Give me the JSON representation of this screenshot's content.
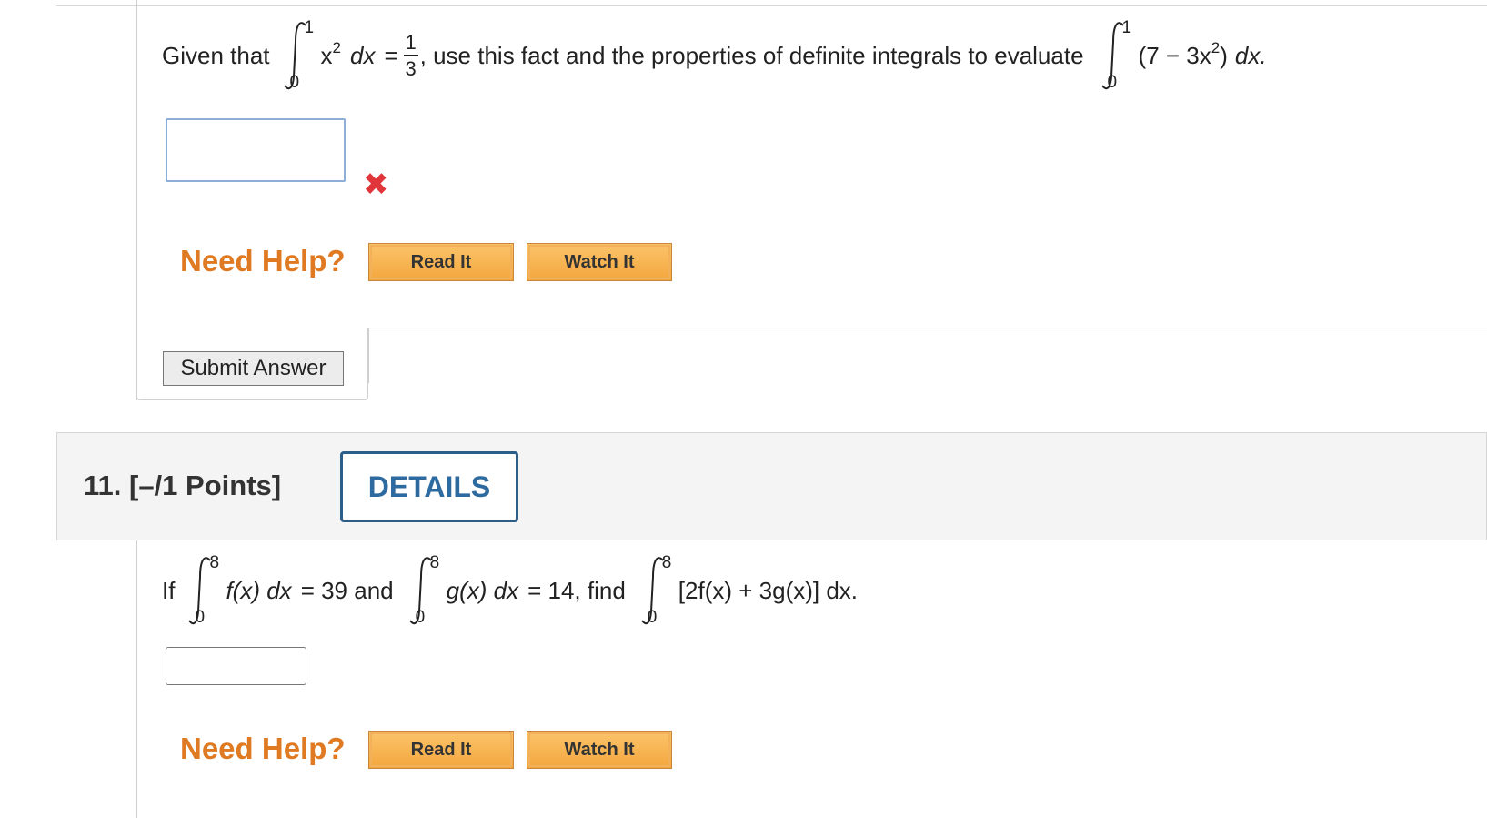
{
  "q10": {
    "given_text": "Given that",
    "integral1": {
      "upper": "1",
      "lower": "0",
      "integrand": "x",
      "exp": "2",
      "dx": "dx",
      "equals": "="
    },
    "fraction": {
      "num": "1",
      "den": "3"
    },
    "middle_text": ", use this fact and the properties of definite integrals to evaluate",
    "integral2": {
      "upper": "1",
      "lower": "0",
      "integrand_open": "(7 − 3x",
      "exp": "2",
      "integrand_close": ")",
      "dx": "dx."
    },
    "answer_value": "",
    "status_icon": "incorrect-x-icon",
    "need_help": "Need Help?",
    "read_it": "Read It",
    "watch_it": "Watch It",
    "submit": "Submit Answer"
  },
  "q11": {
    "number_points": "11.  [–/1 Points]",
    "details": "DETAILS",
    "if_text": "If",
    "integral_f": {
      "upper": "8",
      "lower": "0",
      "expr": "f(x) dx",
      "rhs": "= 39 and"
    },
    "integral_g": {
      "upper": "8",
      "lower": "0",
      "expr": "g(x) dx",
      "rhs": "= 14, find"
    },
    "integral_h": {
      "upper": "8",
      "lower": "0",
      "expr": "[2f(x) + 3g(x)] dx."
    },
    "answer_value": "",
    "need_help": "Need Help?",
    "read_it": "Read It",
    "watch_it": "Watch It"
  },
  "colors": {
    "need_help": "#e07a22",
    "help_button": "#f4a63e",
    "details_border": "#2c5e8a",
    "error_x": "#e0353a"
  }
}
